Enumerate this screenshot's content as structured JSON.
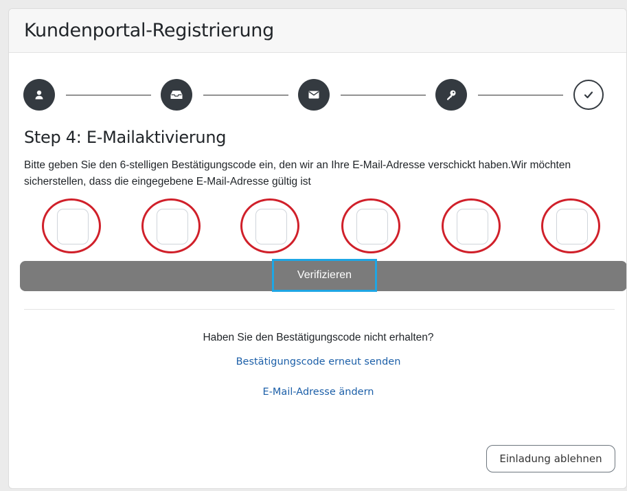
{
  "header": {
    "title": "Kundenportal-Registrierung"
  },
  "stepper": {
    "steps": [
      {
        "icon": "user-icon",
        "state": "completed"
      },
      {
        "icon": "inbox-icon",
        "state": "completed"
      },
      {
        "icon": "envelope-icon",
        "state": "completed"
      },
      {
        "icon": "key-icon",
        "state": "completed"
      },
      {
        "icon": "check-icon",
        "state": "pending"
      }
    ]
  },
  "main": {
    "step_title": "Step 4: E-Mailaktivierung",
    "instruction": "Bitte geben Sie den 6-stelligen Bestätigungscode ein, den wir an Ihre E-Mail-Adresse verschickt haben.Wir möchten sicherstellen, dass die eingegebene E-Mail-Adresse gültig ist",
    "code_digits": [
      "",
      "",
      "",
      "",
      "",
      ""
    ],
    "verify_label": "Verifizieren",
    "resend_question": "Haben Sie den Bestätigungscode nicht erhalten?",
    "resend_link": "Bestätigungscode erneut senden",
    "change_email_link": "E-Mail-Adresse ändern",
    "decline_label": "Einladung ablehnen"
  },
  "colors": {
    "step_dark": "#343a40",
    "highlight_ring": "#d0202a",
    "focus_border": "#1ea6e4",
    "button_gray": "#7b7b7b",
    "link_blue": "#1c5fa8"
  }
}
